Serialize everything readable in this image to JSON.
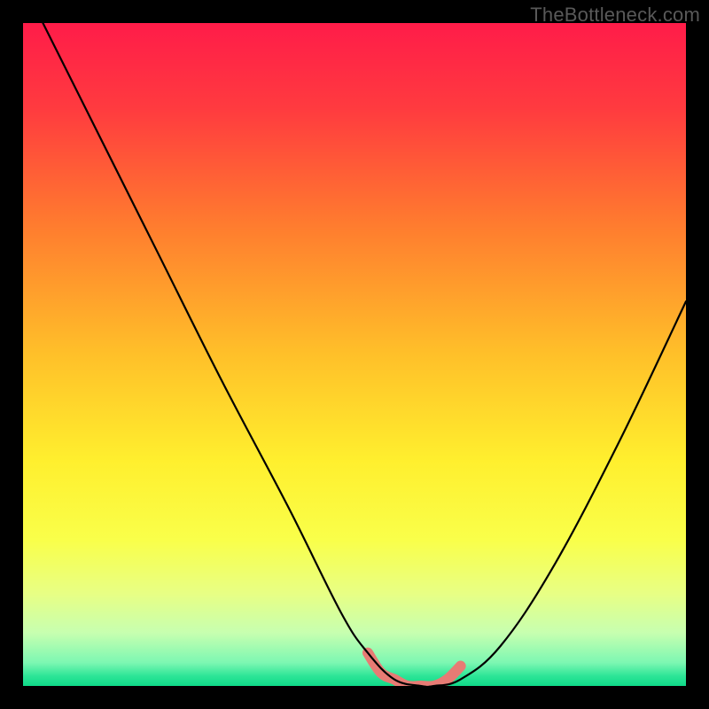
{
  "watermark": "TheBottleneck.com",
  "chart_data": {
    "type": "line",
    "title": "",
    "xlabel": "",
    "ylabel": "",
    "xlim": [
      0,
      100
    ],
    "ylim": [
      0,
      100
    ],
    "grid": false,
    "legend": false,
    "annotations": [],
    "series": [
      {
        "name": "bottleneck-curve",
        "color": "#000000",
        "x": [
          3,
          10,
          20,
          30,
          40,
          48,
          52,
          56,
          60,
          62,
          66,
          72,
          80,
          90,
          100
        ],
        "y": [
          100,
          86,
          66,
          46,
          27,
          11,
          5,
          1,
          0,
          0,
          1,
          6,
          18,
          37,
          58
        ]
      },
      {
        "name": "optimal-range-highlight",
        "color": "#e77b74",
        "x": [
          52,
          54,
          56,
          58,
          60,
          62,
          64,
          66
        ],
        "y": [
          5,
          2,
          1,
          0,
          0,
          0,
          1,
          3
        ]
      }
    ],
    "background_gradient": {
      "stops": [
        {
          "pos": 0.0,
          "color": "#ff1c49"
        },
        {
          "pos": 0.13,
          "color": "#ff3b3f"
        },
        {
          "pos": 0.3,
          "color": "#ff7a2f"
        },
        {
          "pos": 0.5,
          "color": "#ffc029"
        },
        {
          "pos": 0.66,
          "color": "#ffef2e"
        },
        {
          "pos": 0.78,
          "color": "#f9ff4a"
        },
        {
          "pos": 0.86,
          "color": "#e8ff84"
        },
        {
          "pos": 0.92,
          "color": "#c7ffb0"
        },
        {
          "pos": 0.965,
          "color": "#7cf7b2"
        },
        {
          "pos": 0.985,
          "color": "#2de597"
        },
        {
          "pos": 1.0,
          "color": "#0fd988"
        }
      ]
    }
  }
}
